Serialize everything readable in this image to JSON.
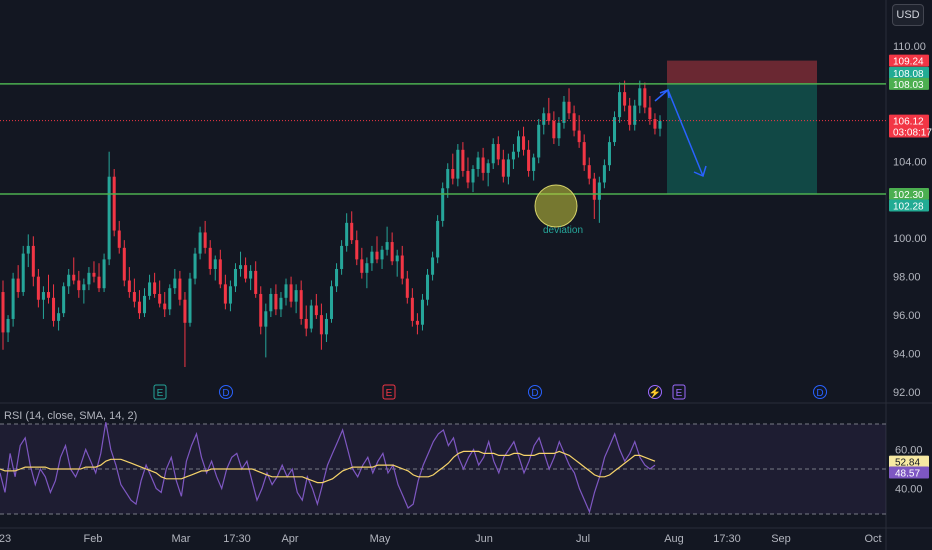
{
  "currency": "USD",
  "price_axis": {
    "ticks": [
      "110.00",
      "108.00",
      "106.00",
      "104.00",
      "102.00",
      "100.00",
      "98.00",
      "96.00",
      "94.00",
      "92.00"
    ],
    "tick_values": [
      110,
      108,
      106,
      104,
      102,
      100,
      98,
      96,
      94,
      92
    ],
    "badges": [
      {
        "text": "109.24",
        "value": 109.24,
        "color": "#f23645"
      },
      {
        "text": "108.08",
        "value": 108.6,
        "color": "#22ab94"
      },
      {
        "text": "108.03",
        "value": 108.03,
        "color": "#4caf50"
      },
      {
        "text": "106.12",
        "value": 106.12,
        "color": "#f23645"
      },
      {
        "text": "03:08:17",
        "value": 105.55,
        "color": "#f23645"
      },
      {
        "text": "102.30",
        "value": 102.3,
        "color": "#4caf50"
      },
      {
        "text": "102.28",
        "value": 101.7,
        "color": "#22ab94"
      }
    ]
  },
  "rsi_axis": {
    "ticks": [
      "60.00",
      "40.00"
    ],
    "tick_values": [
      60,
      40
    ],
    "badges": [
      {
        "text": "52.84",
        "value": 53.8,
        "color": "#f7e9a2",
        "text_color": "#131722"
      },
      {
        "text": "48.57",
        "value": 48.2,
        "color": "#7e57c2",
        "text_color": "#ffffff"
      }
    ]
  },
  "time_axis": {
    "labels": [
      "23",
      "Feb",
      "Mar",
      "17:30",
      "Apr",
      "May",
      "Jun",
      "Jul",
      "Aug",
      "17:30",
      "Sep",
      "Oct"
    ]
  },
  "rsi_legend": "RSI (14, close, SMA, 14, 2)",
  "annotation": "deviation",
  "event_markers": [
    "E",
    "D",
    "E",
    "D",
    "E",
    "D"
  ],
  "levels": {
    "resistance": 108.03,
    "support": 102.3,
    "last_price": 106.12
  },
  "colors": {
    "up": "#26a69a",
    "down": "#f23645",
    "level": "#4caf50",
    "rsi": "#7e57c2",
    "rsi_ma": "#f7d46a",
    "arrow": "#2962ff",
    "stop_zone": "#7a2b35",
    "target_zone": "#12514b"
  },
  "chart_data": [
    {
      "type": "candlestick",
      "title": "",
      "xlabel": "",
      "ylabel": "USD",
      "ylim": [
        92,
        110
      ],
      "grid": false,
      "note": "daily OHLC, approx. Jan – Jul",
      "ohlc": [
        [
          97.2,
          97.8,
          94.2,
          95.1
        ],
        [
          95.1,
          96.0,
          94.6,
          95.8
        ],
        [
          95.8,
          98.2,
          95.4,
          97.9
        ],
        [
          97.9,
          98.6,
          96.9,
          97.2
        ],
        [
          97.2,
          99.6,
          97.0,
          99.2
        ],
        [
          99.2,
          100.2,
          98.5,
          99.6
        ],
        [
          99.6,
          100.1,
          97.5,
          98.0
        ],
        [
          98.0,
          98.4,
          96.4,
          96.8
        ],
        [
          96.8,
          97.5,
          95.8,
          97.2
        ],
        [
          97.2,
          98.1,
          96.6,
          96.9
        ],
        [
          96.9,
          97.6,
          95.4,
          95.7
        ],
        [
          95.7,
          96.4,
          95.2,
          96.1
        ],
        [
          96.1,
          97.7,
          95.9,
          97.5
        ],
        [
          97.5,
          98.4,
          97.1,
          98.1
        ],
        [
          98.1,
          99.0,
          97.6,
          97.8
        ],
        [
          97.8,
          98.3,
          96.9,
          97.3
        ],
        [
          97.3,
          97.9,
          96.6,
          97.6
        ],
        [
          97.6,
          98.5,
          97.3,
          98.2
        ],
        [
          98.2,
          98.8,
          97.7,
          98.0
        ],
        [
          98.0,
          98.7,
          97.2,
          97.4
        ],
        [
          97.4,
          99.2,
          97.2,
          98.9
        ],
        [
          98.9,
          104.5,
          98.6,
          103.2
        ],
        [
          103.2,
          103.6,
          100.1,
          100.4
        ],
        [
          100.4,
          100.9,
          99.2,
          99.5
        ],
        [
          99.5,
          99.9,
          97.5,
          97.8
        ],
        [
          97.8,
          98.5,
          96.9,
          97.2
        ],
        [
          97.2,
          97.9,
          96.4,
          96.7
        ],
        [
          96.7,
          97.3,
          95.8,
          96.1
        ],
        [
          96.1,
          97.4,
          95.9,
          97.0
        ],
        [
          97.0,
          98.1,
          96.8,
          97.7
        ],
        [
          97.7,
          98.2,
          96.9,
          97.1
        ],
        [
          97.1,
          97.8,
          96.4,
          96.6
        ],
        [
          96.6,
          97.2,
          95.9,
          96.3
        ],
        [
          96.3,
          97.6,
          96.0,
          97.4
        ],
        [
          97.4,
          98.4,
          97.1,
          97.9
        ],
        [
          97.9,
          98.3,
          96.5,
          96.8
        ],
        [
          96.8,
          97.2,
          93.3,
          95.6
        ],
        [
          95.6,
          98.2,
          95.4,
          97.9
        ],
        [
          97.9,
          99.5,
          97.6,
          99.2
        ],
        [
          99.2,
          100.6,
          98.9,
          100.3
        ],
        [
          100.3,
          100.9,
          99.2,
          99.5
        ],
        [
          99.5,
          99.9,
          98.1,
          98.4
        ],
        [
          98.4,
          99.1,
          97.8,
          98.9
        ],
        [
          98.9,
          99.4,
          97.4,
          97.6
        ],
        [
          97.6,
          98.1,
          96.3,
          96.6
        ],
        [
          96.6,
          97.8,
          96.2,
          97.5
        ],
        [
          97.5,
          98.7,
          97.2,
          98.4
        ],
        [
          98.4,
          99.3,
          98.0,
          98.6
        ],
        [
          98.6,
          99.0,
          97.7,
          97.9
        ],
        [
          97.9,
          98.6,
          97.3,
          98.3
        ],
        [
          98.3,
          98.8,
          96.9,
          97.1
        ],
        [
          97.1,
          97.5,
          95.0,
          95.4
        ],
        [
          95.4,
          96.6,
          93.8,
          96.2
        ],
        [
          96.2,
          97.4,
          95.9,
          97.1
        ],
        [
          97.1,
          97.6,
          96.0,
          96.3
        ],
        [
          96.3,
          97.2,
          95.9,
          96.9
        ],
        [
          96.9,
          97.9,
          96.5,
          97.6
        ],
        [
          97.6,
          98.0,
          96.4,
          96.7
        ],
        [
          96.7,
          97.6,
          96.1,
          97.3
        ],
        [
          97.3,
          97.8,
          95.5,
          95.8
        ],
        [
          95.8,
          96.5,
          94.9,
          95.3
        ],
        [
          95.3,
          96.8,
          95.1,
          96.5
        ],
        [
          96.5,
          97.1,
          95.8,
          96.0
        ],
        [
          96.0,
          96.6,
          94.2,
          95.0
        ],
        [
          95.0,
          96.1,
          94.6,
          95.8
        ],
        [
          95.8,
          97.8,
          95.6,
          97.5
        ],
        [
          97.5,
          98.7,
          97.2,
          98.4
        ],
        [
          98.4,
          99.9,
          98.1,
          99.6
        ],
        [
          99.6,
          101.3,
          99.3,
          100.8
        ],
        [
          100.8,
          101.4,
          99.7,
          99.9
        ],
        [
          99.9,
          100.4,
          98.6,
          98.9
        ],
        [
          98.9,
          99.5,
          97.9,
          98.2
        ],
        [
          98.2,
          99.0,
          97.4,
          98.7
        ],
        [
          98.7,
          99.6,
          98.3,
          99.3
        ],
        [
          99.3,
          100.1,
          98.7,
          98.9
        ],
        [
          98.9,
          99.6,
          98.4,
          99.4
        ],
        [
          99.4,
          100.6,
          99.1,
          99.8
        ],
        [
          99.8,
          100.3,
          98.6,
          98.8
        ],
        [
          98.8,
          99.4,
          98.0,
          99.1
        ],
        [
          99.1,
          99.6,
          97.6,
          97.9
        ],
        [
          97.9,
          98.3,
          96.6,
          96.9
        ],
        [
          96.9,
          97.4,
          95.4,
          95.7
        ],
        [
          95.7,
          96.1,
          95.0,
          95.5
        ],
        [
          95.5,
          97.1,
          95.2,
          96.8
        ],
        [
          96.8,
          98.4,
          96.5,
          98.1
        ],
        [
          98.1,
          99.3,
          97.8,
          99.0
        ],
        [
          99.0,
          101.2,
          98.7,
          100.9
        ],
        [
          100.9,
          102.9,
          100.6,
          102.6
        ],
        [
          102.6,
          103.9,
          102.1,
          103.6
        ],
        [
          103.6,
          104.4,
          102.8,
          103.1
        ],
        [
          103.1,
          104.9,
          102.7,
          104.6
        ],
        [
          104.6,
          105.0,
          103.2,
          103.5
        ],
        [
          103.5,
          104.2,
          102.6,
          102.9
        ],
        [
          102.9,
          103.8,
          102.4,
          103.6
        ],
        [
          103.6,
          104.5,
          103.2,
          104.2
        ],
        [
          104.2,
          104.7,
          103.0,
          103.4
        ],
        [
          103.4,
          104.1,
          102.7,
          103.9
        ],
        [
          103.9,
          105.2,
          103.6,
          104.9
        ],
        [
          104.9,
          105.3,
          103.8,
          104.1
        ],
        [
          104.1,
          104.6,
          102.9,
          103.2
        ],
        [
          103.2,
          104.4,
          102.8,
          104.1
        ],
        [
          104.1,
          104.9,
          103.6,
          104.5
        ],
        [
          104.5,
          105.6,
          104.2,
          105.3
        ],
        [
          105.3,
          105.8,
          104.3,
          104.6
        ],
        [
          104.6,
          105.1,
          103.2,
          103.5
        ],
        [
          103.5,
          104.4,
          103.0,
          104.2
        ],
        [
          104.2,
          106.2,
          103.9,
          105.9
        ],
        [
          105.9,
          106.8,
          105.4,
          106.5
        ],
        [
          106.5,
          107.3,
          105.9,
          106.1
        ],
        [
          106.1,
          106.6,
          104.9,
          105.2
        ],
        [
          105.2,
          106.3,
          104.8,
          106.0
        ],
        [
          106.0,
          107.4,
          105.7,
          107.1
        ],
        [
          107.1,
          107.8,
          106.2,
          106.5
        ],
        [
          106.5,
          106.9,
          105.3,
          105.6
        ],
        [
          105.6,
          106.4,
          104.7,
          105.0
        ],
        [
          105.0,
          105.4,
          103.5,
          103.8
        ],
        [
          103.8,
          104.2,
          102.8,
          103.1
        ],
        [
          103.1,
          103.4,
          101.0,
          102.0
        ],
        [
          102.0,
          103.2,
          100.8,
          102.9
        ],
        [
          102.9,
          104.1,
          102.6,
          103.8
        ],
        [
          103.8,
          105.3,
          103.5,
          105.0
        ],
        [
          105.0,
          106.6,
          104.8,
          106.3
        ],
        [
          106.3,
          108.1,
          106.0,
          107.6
        ],
        [
          107.6,
          108.2,
          106.6,
          106.9
        ],
        [
          106.9,
          107.3,
          105.6,
          105.9
        ],
        [
          105.9,
          107.2,
          105.6,
          106.9
        ],
        [
          106.9,
          108.2,
          106.5,
          107.8
        ],
        [
          107.8,
          108.1,
          106.5,
          106.8
        ],
        [
          106.8,
          107.4,
          105.9,
          106.2
        ],
        [
          106.2,
          106.5,
          105.4,
          105.7
        ],
        [
          105.7,
          106.4,
          105.3,
          106.1
        ]
      ]
    },
    {
      "type": "line",
      "title": "",
      "xlabel": "",
      "ylabel": "",
      "ylim": [
        20,
        80
      ],
      "series": [
        {
          "name": "RSI (14, close, SMA, 14, 2)",
          "values": [
            48,
            38,
            58,
            46,
            62,
            66,
            52,
            42,
            50,
            46,
            38,
            44,
            56,
            62,
            50,
            46,
            52,
            60,
            54,
            48,
            58,
            74,
            60,
            52,
            42,
            38,
            34,
            32,
            44,
            52,
            46,
            40,
            38,
            50,
            56,
            44,
            36,
            54,
            62,
            68,
            56,
            48,
            54,
            46,
            40,
            50,
            56,
            58,
            50,
            54,
            44,
            34,
            40,
            48,
            42,
            46,
            52,
            46,
            50,
            38,
            34,
            46,
            40,
            32,
            42,
            52,
            58,
            64,
            70,
            60,
            50,
            46,
            52,
            56,
            48,
            54,
            58,
            48,
            52,
            42,
            36,
            30,
            32,
            44,
            52,
            58,
            64,
            68,
            70,
            62,
            66,
            56,
            50,
            56,
            60,
            52,
            56,
            64,
            54,
            48,
            56,
            60,
            64,
            56,
            48,
            54,
            62,
            66,
            58,
            50,
            56,
            64,
            58,
            52,
            48,
            40,
            34,
            28,
            38,
            46,
            56,
            62,
            68,
            60,
            54,
            58,
            64,
            56,
            52,
            50,
            52
          ]
        },
        {
          "name": "",
          "values": [
            50,
            49,
            49,
            49,
            50,
            51,
            51,
            51,
            51,
            51,
            50,
            50,
            50,
            50,
            50,
            50,
            50,
            51,
            51,
            51,
            52,
            54,
            55,
            55,
            55,
            54,
            53,
            52,
            51,
            50,
            49,
            48,
            46,
            45,
            45,
            45,
            45,
            46,
            47,
            48,
            49,
            49,
            50,
            50,
            50,
            50,
            50,
            50,
            50,
            50,
            50,
            49,
            48,
            47,
            46,
            46,
            46,
            46,
            46,
            46,
            46,
            45,
            44,
            43,
            43,
            44,
            45,
            47,
            49,
            50,
            51,
            51,
            51,
            51,
            51,
            52,
            52,
            52,
            52,
            51,
            50,
            49,
            47,
            46,
            46,
            46,
            47,
            49,
            51,
            53,
            56,
            58,
            59,
            59,
            59,
            59,
            58,
            58,
            58,
            57,
            57,
            57,
            58,
            58,
            57,
            57,
            57,
            58,
            58,
            58,
            58,
            59,
            58,
            57,
            55,
            53,
            51,
            49,
            47,
            46,
            46,
            47,
            49,
            51,
            53,
            55,
            57,
            57,
            56,
            55,
            54
          ]
        }
      ]
    }
  ]
}
